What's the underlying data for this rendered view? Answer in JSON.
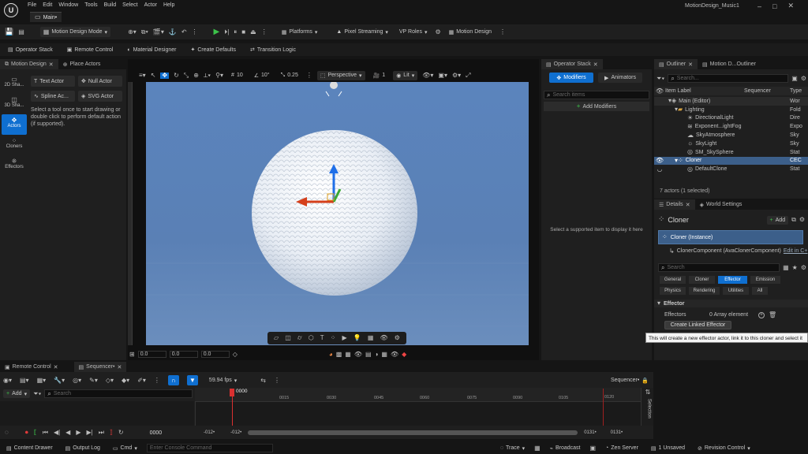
{
  "window": {
    "menus": [
      "File",
      "Edit",
      "Window",
      "Tools",
      "Build",
      "Select",
      "Actor",
      "Help"
    ],
    "doc_tab": "Main•",
    "project": "MotionDesign_Music1"
  },
  "toolbar": {
    "mode": "Motion Design Mode",
    "platforms": "Platforms",
    "pixel_streaming": "Pixel Streaming",
    "vp_roles": "VP Roles",
    "motion_design": "Motion Design"
  },
  "toolbar2": {
    "items": [
      "Operator Stack",
      "Remote Control",
      "Material Designer",
      "Create Defaults",
      "Transition Logic"
    ]
  },
  "left": {
    "tabs": [
      "Motion Design",
      "Place Actors"
    ],
    "nav": [
      "2D Sha...",
      "3D Sha...",
      "Actors",
      "Cloners",
      "Effectors"
    ],
    "actors": [
      "Text Actor",
      "Null Actor",
      "Spline Ac...",
      "SVG Actor"
    ],
    "hint": "Select a tool once to start drawing or double click to perform default action (if supported)."
  },
  "viewport": {
    "view": "Perspective",
    "lit": "Lit",
    "grid": "10",
    "rot": "10°",
    "scale": "0.25",
    "cam": "1",
    "fields": [
      "0.0",
      "0.0",
      "0.0"
    ]
  },
  "opstack": {
    "tab": "Operator Stack",
    "modifiers": "Modifiers",
    "animators": "Animators",
    "search_placeholder": "Search items",
    "add": "Add Modifiers",
    "empty": "Select a supported item to display it here"
  },
  "outliner": {
    "tabs": [
      "Outliner",
      "Motion D...Outliner"
    ],
    "search_placeholder": "Search...",
    "cols": [
      "Item Label",
      "Sequencer",
      "Type"
    ],
    "rows": [
      {
        "label": "Main (Editor)",
        "type": "Wor"
      },
      {
        "label": "Lighting",
        "type": "Fold"
      },
      {
        "label": "DirectionalLight",
        "type": "Dire"
      },
      {
        "label": "Exponent...ightFog",
        "type": "Expo"
      },
      {
        "label": "SkyAtmosphere",
        "type": "Sky"
      },
      {
        "label": "SkyLight",
        "type": "Sky"
      },
      {
        "label": "SM_SkySphere",
        "type": "Stat"
      },
      {
        "label": "Cloner",
        "type": "CEC"
      },
      {
        "label": "DefaultClone",
        "type": "Stat"
      }
    ],
    "status": "7 actors (1 selected)"
  },
  "details": {
    "tabs": [
      "Details",
      "World Settings"
    ],
    "name": "Cloner",
    "add": "Add",
    "instance": "Cloner (Instance)",
    "component": "ClonerComponent (AvaClonerComponent)",
    "edit": "Edit in C+",
    "search_placeholder": "Search",
    "cats1": [
      "General",
      "Cloner",
      "Effector",
      "Emission"
    ],
    "cats2": [
      "Physics",
      "Rendering",
      "Utilities",
      "All"
    ],
    "section": "Effector",
    "prop": "Effectors",
    "count": "0 Array element",
    "create": "Create Linked Effector",
    "tooltip": "This will create a new effector actor, link it to this cloner and select it"
  },
  "bottom": {
    "tabs": [
      "Remote Control",
      "Sequencer•"
    ],
    "fps": "59.94 fps",
    "sequencer": "Sequencer•",
    "add": "Add",
    "search_placeholder": "Search",
    "playhead": "0000",
    "ticks": [
      "0015",
      "0030",
      "0045",
      "0060",
      "0075",
      "0090",
      "0105",
      "0120"
    ],
    "start_a": "-012•",
    "start_b": "-012•",
    "end_a": "0131•",
    "end_b": "0131•",
    "time": "0000",
    "selection": "Selection"
  },
  "statusbar": {
    "drawer": "Content Drawer",
    "output": "Output Log",
    "cmd": "Cmd",
    "console_placeholder": "Enter Console Command",
    "trace": "Trace",
    "broadcast": "Broadcast",
    "zen": "Zen Server",
    "unsaved": "1 Unsaved",
    "rc": "Revision Control"
  },
  "colors": {
    "accent": "#0f6fd0",
    "viewport_bg": "#5a80b5",
    "selected_row": "#3c5f8a"
  }
}
